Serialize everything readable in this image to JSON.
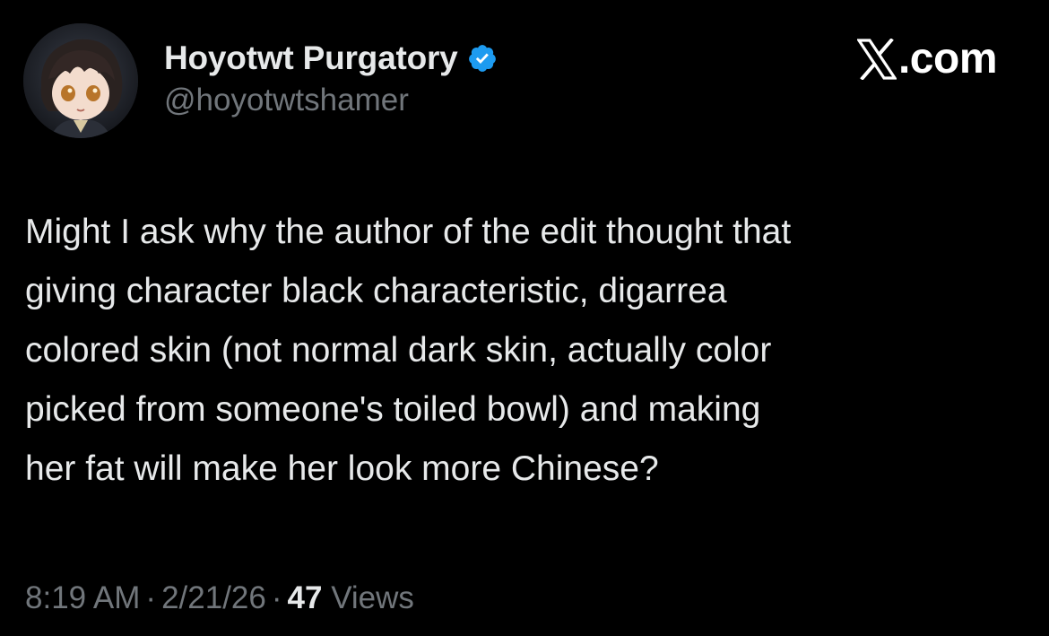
{
  "author": {
    "display_name": "Hoyotwt Purgatory",
    "handle": "@hoyotwtshamer",
    "verified": true
  },
  "brand": {
    "domain": ".com"
  },
  "tweet": {
    "lines": [
      "Might I ask why the author of the edit thought that",
      "giving character black characteristic, digarrea",
      "colored skin (not normal dark skin, actually color",
      "picked from someone's toiled bowl) and making",
      "her fat will make her look more Chinese?"
    ]
  },
  "meta": {
    "time": "8:19 AM",
    "date": "2/21/26",
    "separator": "·",
    "views_count": "47",
    "views_label": "Views"
  },
  "colors": {
    "background": "#000000",
    "text_primary": "#e7e9ea",
    "text_secondary": "#71767b",
    "verified_blue": "#1d9bf0"
  },
  "icons": {
    "avatar": "anime-character-avatar",
    "verified": "verified-badge-icon",
    "brand_logo": "x-logo-icon"
  }
}
